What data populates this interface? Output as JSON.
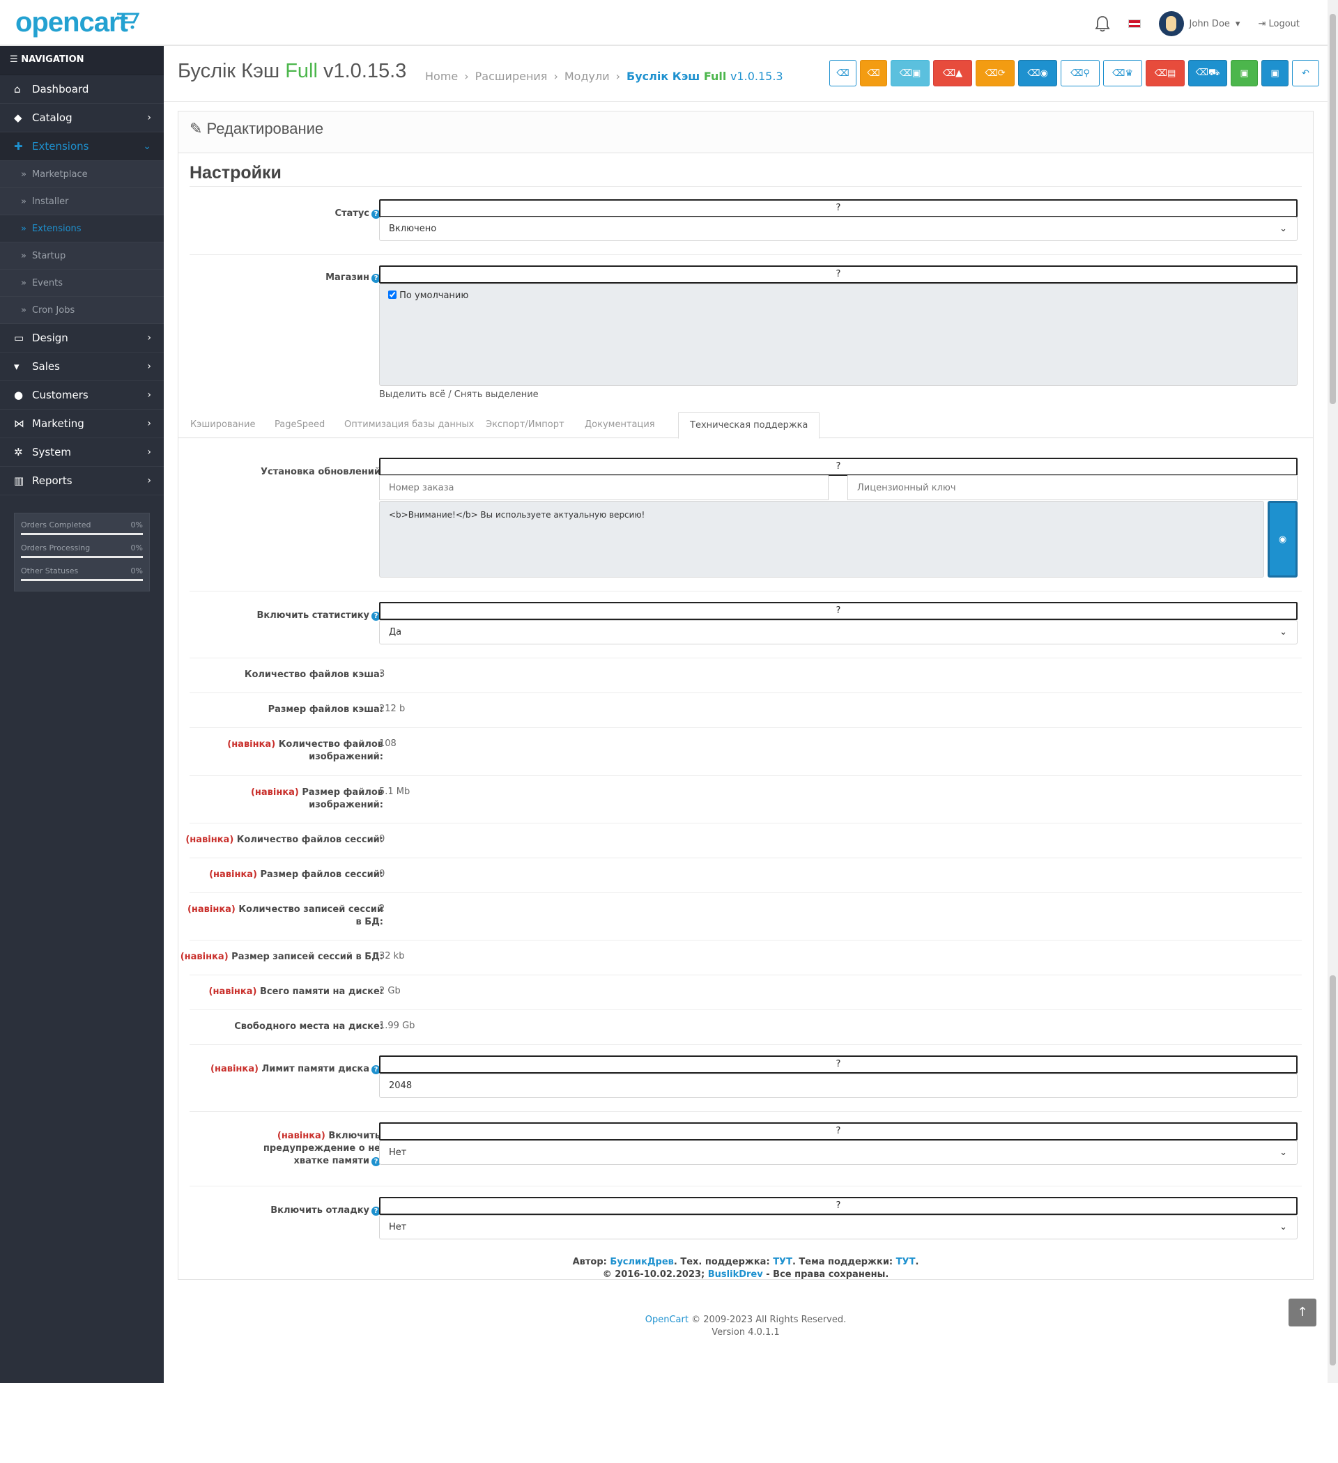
{
  "header": {
    "logo": "opencart",
    "user_name": "John Doe",
    "logout": "Logout"
  },
  "sidebar": {
    "title": "NAVIGATION",
    "items": [
      {
        "label": "Dashboard",
        "icon": "home-icon"
      },
      {
        "label": "Catalog",
        "icon": "tag-icon"
      },
      {
        "label": "Extensions",
        "icon": "puzzle-icon"
      },
      {
        "label": "Design",
        "icon": "monitor-icon"
      },
      {
        "label": "Sales",
        "icon": "cart-icon"
      },
      {
        "label": "Customers",
        "icon": "user-icon"
      },
      {
        "label": "Marketing",
        "icon": "share-icon"
      },
      {
        "label": "System",
        "icon": "gear-icon"
      },
      {
        "label": "Reports",
        "icon": "bar-chart-icon"
      }
    ],
    "sub_items": [
      "Marketplace",
      "Installer",
      "Extensions",
      "Startup",
      "Events",
      "Cron Jobs"
    ],
    "stats": [
      {
        "label": "Orders Completed",
        "value": "0%"
      },
      {
        "label": "Orders Processing",
        "value": "0%"
      },
      {
        "label": "Other Statuses",
        "value": "0%"
      }
    ]
  },
  "page": {
    "title_main": "Буслік Кэш",
    "title_full": "Full",
    "title_version": "v1.0.15.3",
    "breadcrumb": [
      "Home",
      "Расширения",
      "Модули"
    ],
    "breadcrumb_cur_main": "Буслік Кэш",
    "breadcrumb_cur_full": "Full",
    "breadcrumb_cur_version": "v1.0.15.3"
  },
  "panel": {
    "heading": "Редактирование",
    "section": "Настройки",
    "help_mark": "?",
    "status_label": "Статус",
    "status_value": "Включено",
    "store_label": "Магазин",
    "store_default": "По умолчанию",
    "select_all": "Выделить всё / Снять выделение",
    "tabs": [
      "Кэширование",
      "PageSpeed",
      "Оптимизация базы данных",
      "Экспорт/Импорт",
      "Документация",
      "Техническая поддержка"
    ],
    "updates_label": "Установка обновлений",
    "order_placeholder": "Номер заказа",
    "license_placeholder": "Лицензионный ключ",
    "update_message": "<b>Внимание!</b> Вы используете актуальную версию!",
    "stats_label": "Включить статистику",
    "stats_value": "Да",
    "navinka": "(навінка)",
    "info_rows": [
      {
        "label": "Количество файлов кэша:",
        "value": "3",
        "new": false
      },
      {
        "label": "Размер файлов кэша:",
        "value": "212 b",
        "new": false
      },
      {
        "label": "Количество файлов изображений:",
        "value": "108",
        "new": true
      },
      {
        "label": "Размер файлов изображений:",
        "value": "5.1 Mb",
        "new": true
      },
      {
        "label": "Количество файлов сессий:",
        "value": "0",
        "new": true
      },
      {
        "label": "Размер файлов сессий:",
        "value": "0",
        "new": true
      },
      {
        "label": "Количество записей сессий в БД:",
        "value": "2",
        "new": true
      },
      {
        "label": "Размер записей сессий в БД:",
        "value": "32 kb",
        "new": true
      },
      {
        "label": "Всего памяти на диске:",
        "value": "2 Gb",
        "new": true
      },
      {
        "label": "Свободного места на диске:",
        "value": "1.99 Gb",
        "new": false
      }
    ],
    "disk_limit_label": "Лимит памяти диска",
    "disk_limit_value": "2048",
    "warning_label": "Включить предупреждение о не хватке памяти",
    "warning_value": "Нет",
    "debug_label": "Включить отладку",
    "debug_value": "Нет",
    "credit_author": "Автор:",
    "credit_author_link": "БусликДрев",
    "credit_support": ". Тех. поддержка:",
    "credit_support_link": "ТУТ",
    "credit_topic": ". Тема поддержки:",
    "credit_topic_link": "ТУТ",
    "credit_copy": "© 2016-10.02.2023;",
    "credit_copy_link": "BuslikDrev",
    "credit_rights": "- Все права сохранены."
  },
  "footer": {
    "brand": "OpenCart",
    "copyright": "© 2009-2023 All Rights Reserved.",
    "version": "Version 4.0.1.1"
  }
}
